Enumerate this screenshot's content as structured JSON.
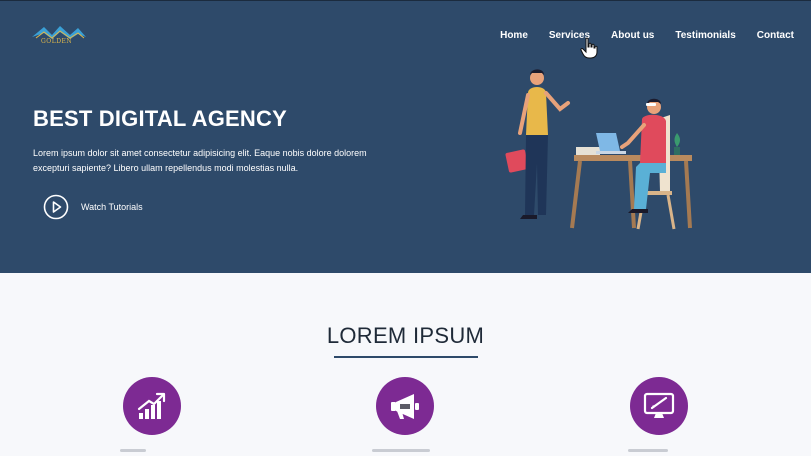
{
  "brand": {
    "logo_text": "GOLDEN"
  },
  "nav": {
    "items": [
      {
        "label": "Home"
      },
      {
        "label": "Services"
      },
      {
        "label": "About us"
      },
      {
        "label": "Testimonials"
      },
      {
        "label": "Contact"
      }
    ]
  },
  "hero": {
    "title": "BEST DIGITAL AGENCY",
    "text": "Lorem ipsum dolor sit amet consectetur adipisicing elit. Eaque nobis dolore dolorem excepturi sapiente? Libero ullam repellendus modi molestias nulla.",
    "cta_label": "Watch Tutorials",
    "illustration": "two-people-office-illustration"
  },
  "section": {
    "title": "LOREM IPSUM",
    "services": [
      {
        "icon": "growth-chart-icon"
      },
      {
        "icon": "megaphone-icon"
      },
      {
        "icon": "design-monitor-icon"
      }
    ]
  },
  "colors": {
    "hero_bg": "#2e4a6a",
    "accent_purple": "#7d2a93",
    "page_bg": "#f7f8fb"
  }
}
